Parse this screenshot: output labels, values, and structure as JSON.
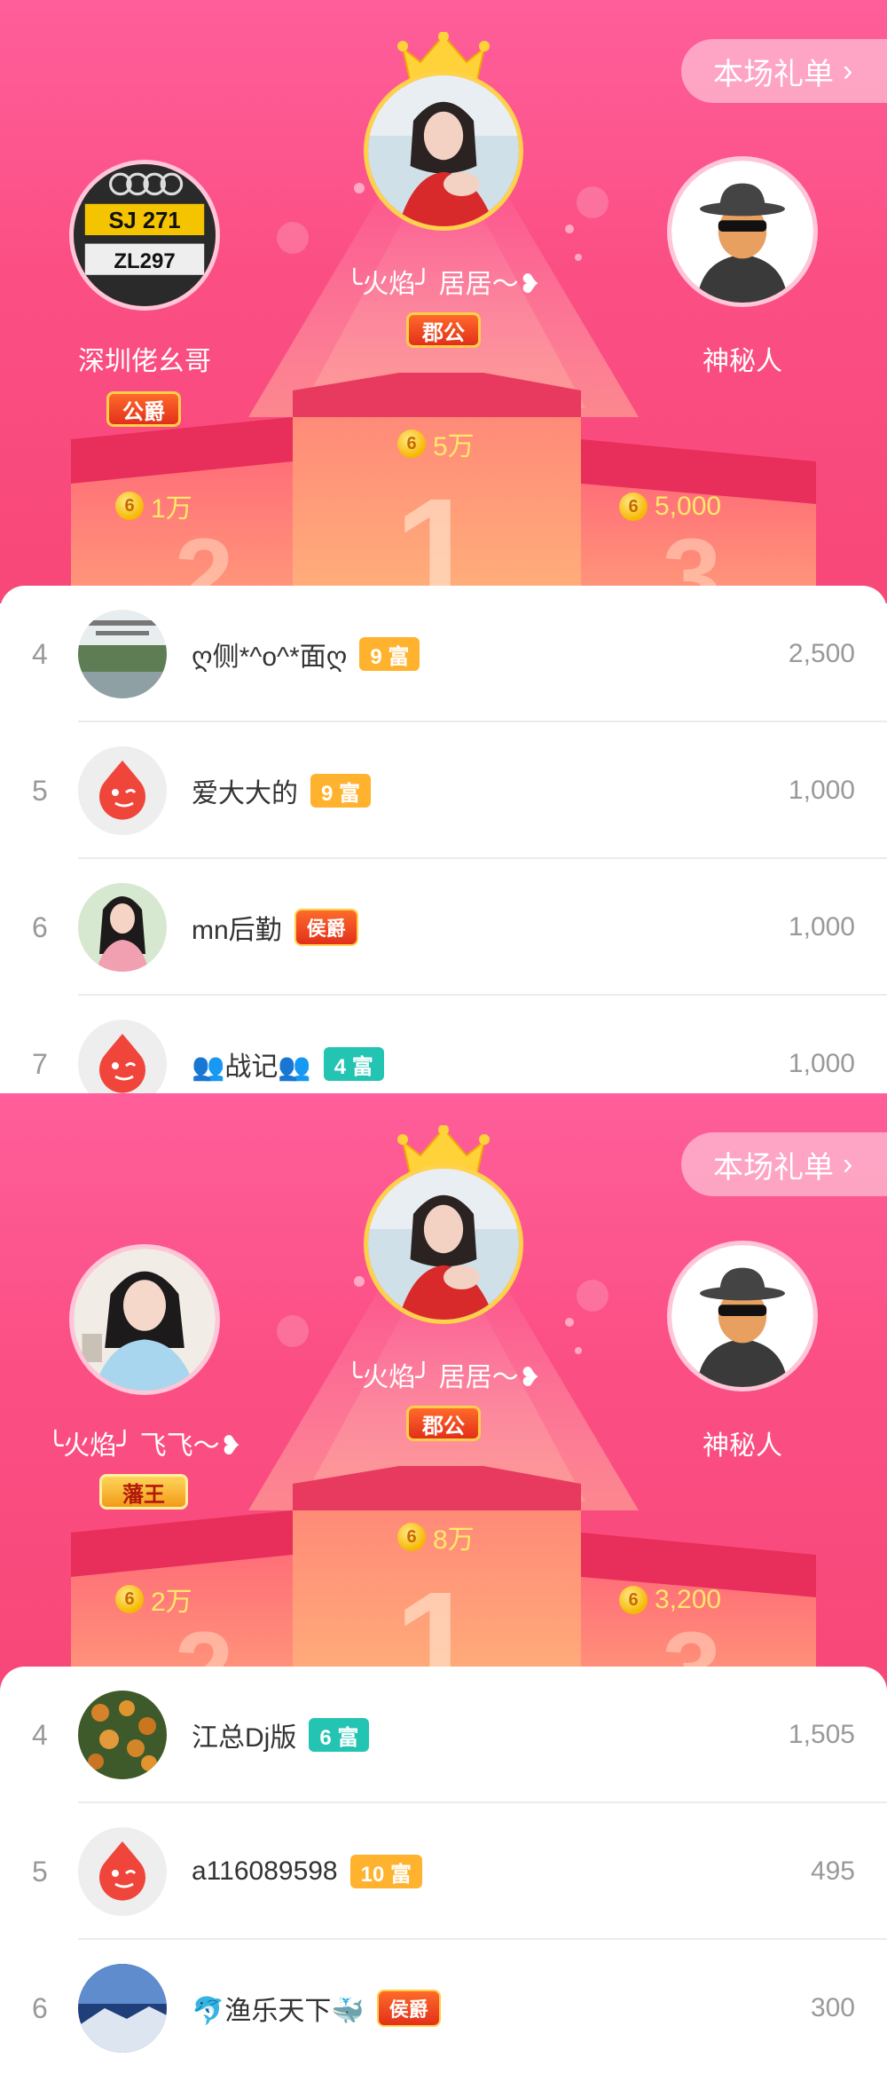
{
  "screens": [
    {
      "gift_list_label": "本场礼单",
      "podium": {
        "first": {
          "name": "╰火焰╯ 居居～❥",
          "title": "郡公",
          "amount": "5万"
        },
        "second": {
          "name": "深圳佬幺哥",
          "title": "公爵",
          "amount": "1万"
        },
        "third": {
          "name": "神秘人",
          "amount": "5,000"
        }
      },
      "rows": [
        {
          "rank": "4",
          "name": "ღ侧*^o^*面ღ",
          "badge": "9 富",
          "badge_type": "rich-orange",
          "score": "2,500"
        },
        {
          "rank": "5",
          "name": "爱大大的",
          "badge": "9 富",
          "badge_type": "rich-orange",
          "score": "1,000"
        },
        {
          "rank": "6",
          "name": "mn后勤",
          "badge": "侯爵",
          "badge_type": "noble",
          "score": "1,000"
        },
        {
          "rank": "7",
          "name": "👥战记👥",
          "badge": "4 富",
          "badge_type": "rich-teal",
          "score": "1,000"
        }
      ]
    },
    {
      "gift_list_label": "本场礼单",
      "podium": {
        "first": {
          "name": "╰火焰╯ 居居～❥",
          "title": "郡公",
          "amount": "8万"
        },
        "second": {
          "name": "╰火焰╯ 飞飞～❥",
          "title": "藩王",
          "amount": "2万"
        },
        "third": {
          "name": "神秘人",
          "amount": "3,200"
        }
      },
      "rows": [
        {
          "rank": "4",
          "name": "江总Dj版",
          "badge": "6 富",
          "badge_type": "rich-teal",
          "score": "1,505"
        },
        {
          "rank": "5",
          "name": "a116089598",
          "badge": "10 富",
          "badge_type": "rich-orange",
          "score": "495"
        },
        {
          "rank": "6",
          "name": "🐬渔乐天下🐳",
          "badge": "侯爵",
          "badge_type": "noble",
          "score": "300"
        }
      ]
    }
  ],
  "icons": {
    "coin": "coin-icon",
    "crown": "crown-icon",
    "chevron": "chevron-right-icon"
  },
  "colors": {
    "background_pink": "#fb4f84",
    "gold": "#ffd24a",
    "amount_text": "#ffe86a",
    "rich_orange": "#ffb22e",
    "rich_teal": "#23c4b2"
  }
}
